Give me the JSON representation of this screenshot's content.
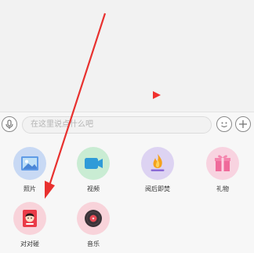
{
  "input_bar": {
    "placeholder": "在这里说点什么吧"
  },
  "panel": {
    "items": [
      {
        "label": "照片",
        "icon": "photo-icon",
        "color": "#c8d9f4"
      },
      {
        "label": "视频",
        "icon": "video-camera-icon",
        "color": "#c9ecd3"
      },
      {
        "label": "阅后即焚",
        "icon": "flame-icon",
        "color": "#ddd3f2"
      },
      {
        "label": "礼物",
        "icon": "gift-icon",
        "color": "#f8d3e0"
      },
      {
        "label": "对对碰",
        "icon": "avatar-card-icon",
        "color": "#f8d3da"
      },
      {
        "label": "音乐",
        "icon": "music-disc-icon",
        "color": "#f8d3da"
      }
    ]
  },
  "colors": {
    "arrow": "#e8312f",
    "play_marker": "#f0312e"
  }
}
